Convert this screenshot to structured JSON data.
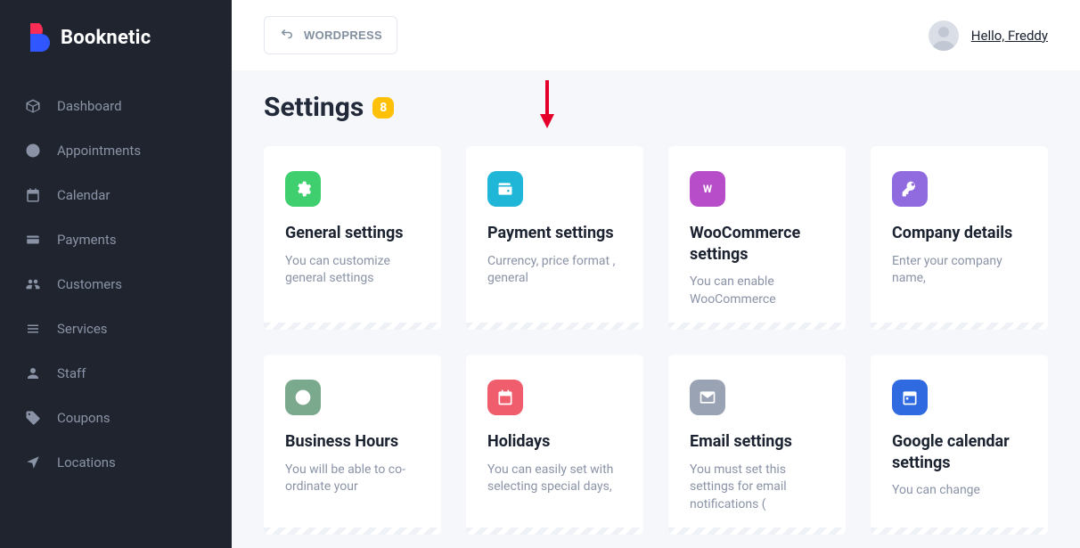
{
  "brand": {
    "name": "Booknetic"
  },
  "header": {
    "wordpress_label": "WORDPRESS",
    "greeting": "Hello, Freddy"
  },
  "sidebar": {
    "items": [
      {
        "label": "Dashboard"
      },
      {
        "label": "Appointments"
      },
      {
        "label": "Calendar"
      },
      {
        "label": "Payments"
      },
      {
        "label": "Customers"
      },
      {
        "label": "Services"
      },
      {
        "label": "Staff"
      },
      {
        "label": "Coupons"
      },
      {
        "label": "Locations"
      }
    ]
  },
  "page": {
    "title": "Settings",
    "badge": "8"
  },
  "cards": [
    {
      "title": "General settings",
      "desc": "You can customize general settings"
    },
    {
      "title": "Payment settings",
      "desc": "Currency, price format , general"
    },
    {
      "title": "WooCommerce settings",
      "desc": "You can enable WooCommerce"
    },
    {
      "title": "Company details",
      "desc": "Enter your company name,"
    },
    {
      "title": "Business Hours",
      "desc": "You will be able to co-ordinate your"
    },
    {
      "title": "Holidays",
      "desc": "You can easily set with selecting special days,"
    },
    {
      "title": "Email settings",
      "desc": "You must set this settings for email notifications ("
    },
    {
      "title": "Google calendar settings",
      "desc": "You can change"
    }
  ]
}
